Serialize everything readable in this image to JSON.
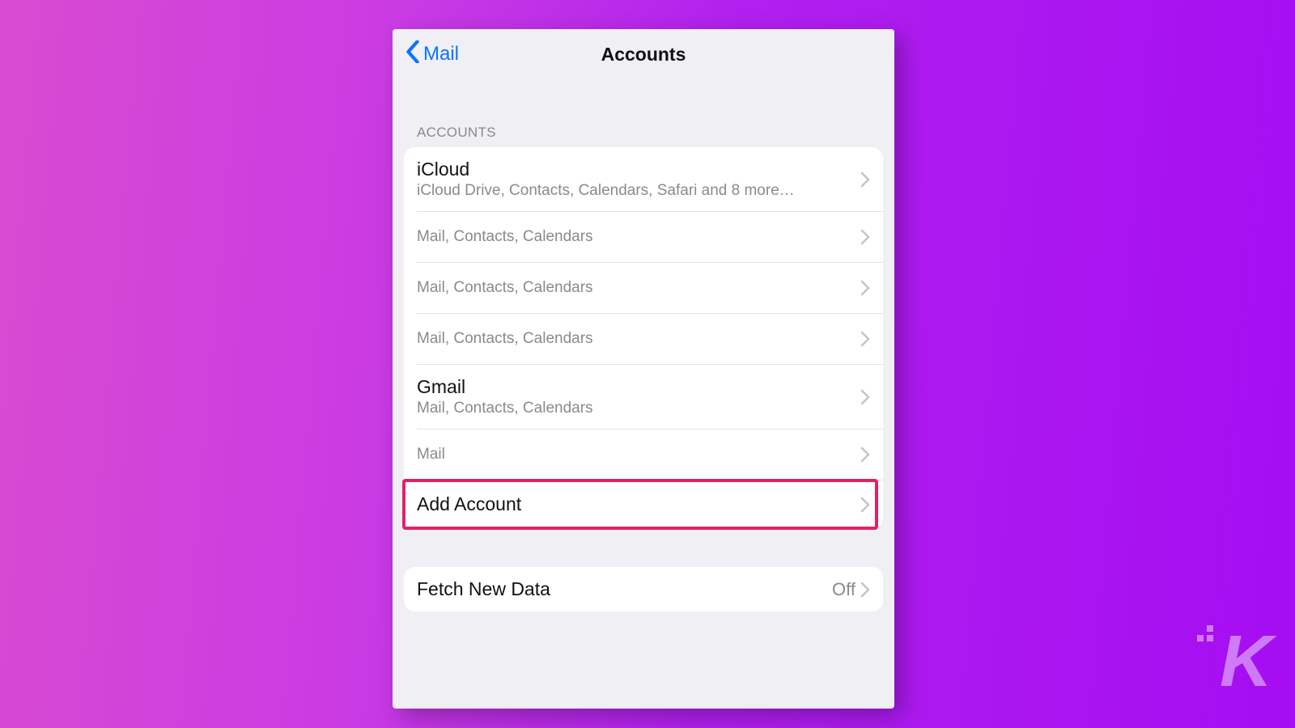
{
  "nav": {
    "back_label": "Mail",
    "title": "Accounts"
  },
  "section_header": "ACCOUNTS",
  "accounts": [
    {
      "title": "iCloud",
      "sub": "iCloud Drive, Contacts, Calendars, Safari and 8 more…"
    },
    {
      "title": "",
      "sub": "Mail, Contacts, Calendars"
    },
    {
      "title": "",
      "sub": "Mail, Contacts, Calendars"
    },
    {
      "title": "",
      "sub": "Mail, Contacts, Calendars"
    },
    {
      "title": "Gmail",
      "sub": "Mail, Contacts, Calendars"
    },
    {
      "title": "",
      "sub": "Mail"
    }
  ],
  "add_account_label": "Add Account",
  "fetch": {
    "label": "Fetch New Data",
    "value": "Off"
  },
  "colors": {
    "ios_blue": "#0a73ff",
    "highlight": "#e22266"
  },
  "watermark": "K"
}
